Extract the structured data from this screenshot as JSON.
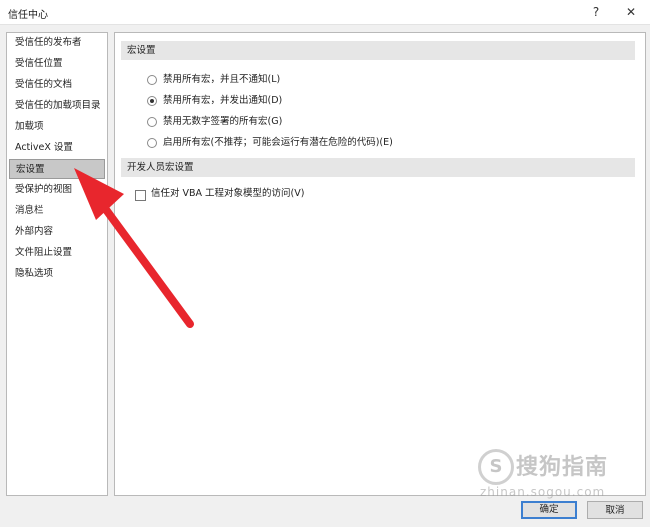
{
  "window": {
    "title": "信任中心",
    "help_glyph": "?",
    "close_glyph": "✕"
  },
  "sidebar": {
    "items": [
      {
        "label": "受信任的发布者"
      },
      {
        "label": "受信任位置"
      },
      {
        "label": "受信任的文档"
      },
      {
        "label": "受信任的加载项目录"
      },
      {
        "label": "加载项"
      },
      {
        "label": "ActiveX 设置"
      },
      {
        "label": "宏设置",
        "selected": true
      },
      {
        "label": "受保护的视图"
      },
      {
        "label": "消息栏"
      },
      {
        "label": "外部内容"
      },
      {
        "label": "文件阻止设置"
      },
      {
        "label": "隐私选项"
      }
    ]
  },
  "macro_section": {
    "header": "宏设置",
    "options": [
      {
        "label": "禁用所有宏，并且不通知(L)",
        "checked": false
      },
      {
        "label": "禁用所有宏，并发出通知(D)",
        "checked": true
      },
      {
        "label": "禁用无数字签署的所有宏(G)",
        "checked": false
      },
      {
        "label": "启用所有宏(不推荐；可能会运行有潜在危险的代码)(E)",
        "checked": false
      }
    ]
  },
  "dev_section": {
    "header": "开发人员宏设置",
    "checkbox_label": "信任对 VBA 工程对象模型的访问(V)",
    "checked": false
  },
  "footer": {
    "ok_label": "确定",
    "cancel_label": "取消"
  },
  "watermark": {
    "logo_letter": "S",
    "text": "搜狗指南",
    "url": "zhinan.sogou.com"
  },
  "colors": {
    "arrow": "#e8262d",
    "selected_bg": "#c8c8c8",
    "section_bg": "#e6e6e6",
    "default_border": "#3c7fd0"
  }
}
